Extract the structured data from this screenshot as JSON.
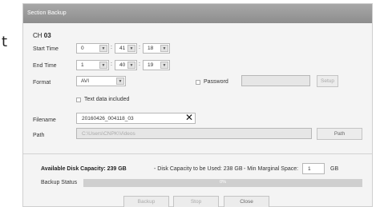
{
  "background": {
    "letter": "t"
  },
  "window": {
    "title": "Section Backup"
  },
  "channel": {
    "prefix": "CH",
    "number": "03"
  },
  "start_time": {
    "label": "Start Time",
    "hour": "0",
    "minute": "41",
    "second": "18"
  },
  "end_time": {
    "label": "End Time",
    "hour": "1",
    "minute": "40",
    "second": "19"
  },
  "format": {
    "label": "Format",
    "value": "AVI"
  },
  "password": {
    "label": "Password",
    "value": "",
    "setup_label": "Setup"
  },
  "text_data": {
    "label": "Text data included"
  },
  "filename": {
    "label": "Filename",
    "value": "20160426_004118_03"
  },
  "path": {
    "label": "Path",
    "value": "C:\\Users\\CNPK\\Videos",
    "button_label": "Path"
  },
  "disk": {
    "available": "Available Disk Capacity: 239 GB",
    "to_be_used": "- Disk Capacity to be Used: 238 GB",
    "min_margin_label": "- Min Marginal Space:",
    "min_margin_value": "1",
    "min_margin_unit": "GB"
  },
  "status": {
    "label": "Backup Status",
    "percent_text": "0%",
    "progress_fraction": 0
  },
  "buttons": {
    "backup": "Backup",
    "stop": "Stop",
    "close": "Close"
  },
  "icons": {
    "dropdown": "▼",
    "clear": "✕"
  }
}
